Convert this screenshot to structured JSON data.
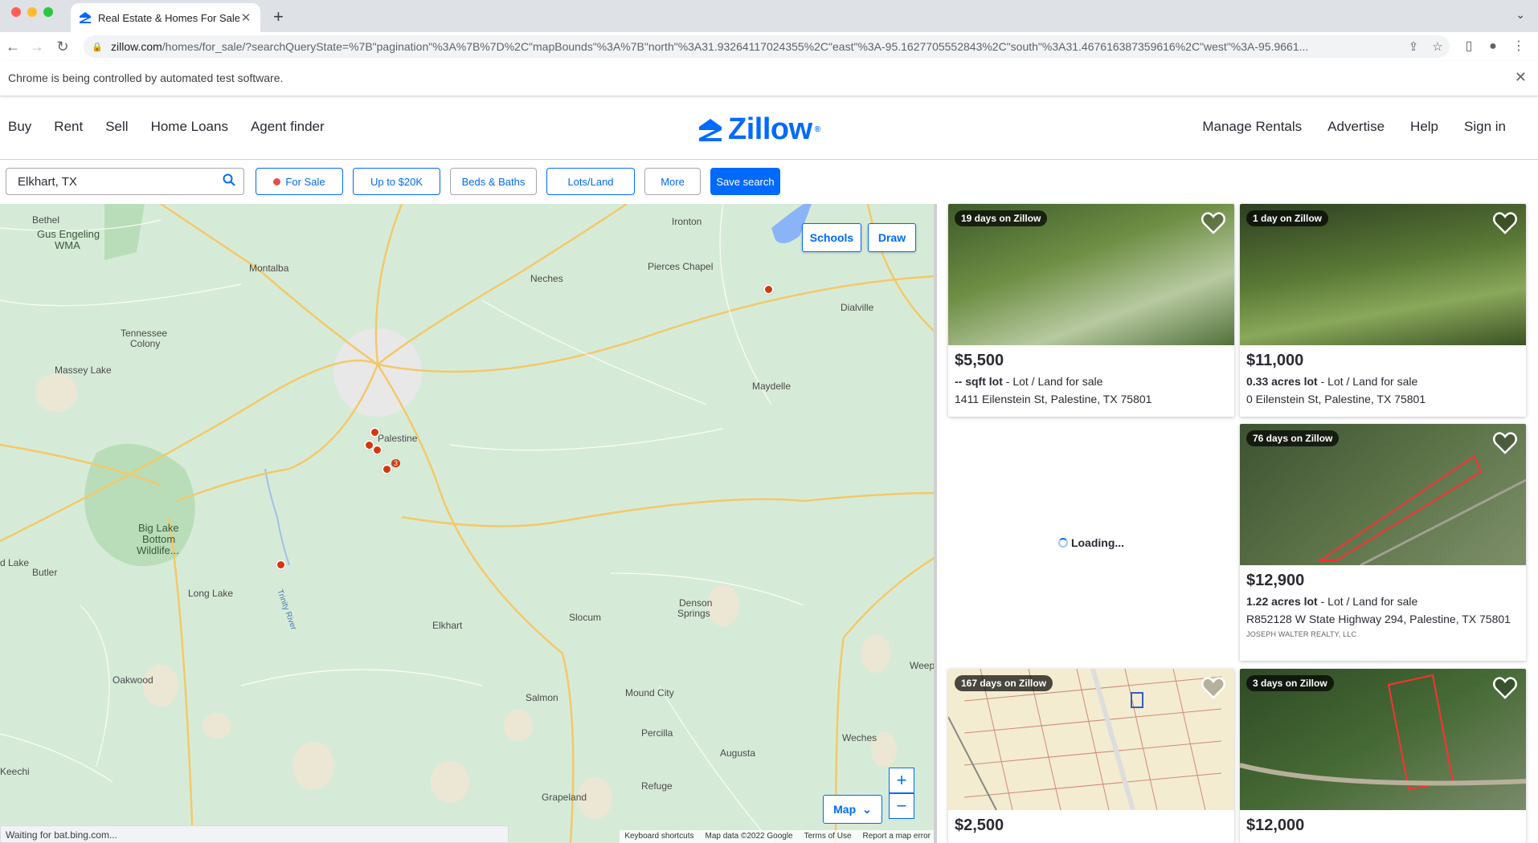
{
  "browser": {
    "tab_title": "Real Estate & Homes For Sale",
    "url_host": "zillow.com",
    "url_path": "/homes/for_sale/?searchQueryState=%7B\"pagination\"%3A%7B%7D%2C\"mapBounds\"%3A%7B\"north\"%3A31.93264117024355%2C\"east\"%3A-95.1627705552843%2C\"south\"%3A31.467616387359616%2C\"west\"%3A-95.9661...",
    "infobar_message": "Chrome is being controlled by automated test software.",
    "status_text": "Waiting for bat.bing.com..."
  },
  "header": {
    "nav_left": [
      "Buy",
      "Rent",
      "Sell",
      "Home Loans",
      "Agent finder"
    ],
    "logo_text": "Zillow",
    "nav_right": [
      "Manage Rentals",
      "Advertise",
      "Help",
      "Sign in"
    ]
  },
  "filters": {
    "search_value": "Elkhart, TX",
    "for_sale": "For Sale",
    "price": "Up to $20K",
    "beds_baths": "Beds & Baths",
    "home_type": "Lots/Land",
    "more": "More",
    "save_search": "Save search"
  },
  "map": {
    "schools_label": "Schools",
    "draw_label": "Draw",
    "map_type": "Map",
    "zoom_in": "+",
    "zoom_out": "−",
    "attribution": [
      "Keyboard shortcuts",
      "Map data ©2022 Google",
      "Terms of Use",
      "Report a map error"
    ],
    "places": {
      "bethel": "Bethel",
      "gus_engeling": "Gus Engeling",
      "wma": "WMA",
      "ironton": "Ironton",
      "montalba": "Montalba",
      "neches": "Neches",
      "pierces_chapel": "Pierces Chapel",
      "dialville": "Dialville",
      "tennessee": "Tennessee",
      "colony": "Colony",
      "massey_lake": "Massey Lake",
      "maydelle": "Maydelle",
      "palestine": "Palestine",
      "big_lake": "Big Lake",
      "bottom": "Bottom",
      "wildlife": "Wildlife...",
      "d_lake": "d Lake",
      "butler": "Butler",
      "long_lake": "Long Lake",
      "trinity_river": "Trinity River",
      "elkhart": "Elkhart",
      "slocum": "Slocum",
      "denson": "Denson",
      "springs": "Springs",
      "oakwood": "Oakwood",
      "salmon": "Salmon",
      "mound_city": "Mound City",
      "percilla": "Percilla",
      "weches": "Weches",
      "augusta": "Augusta",
      "keechi": "Keechi",
      "grapeland": "Grapeland",
      "refuge": "Refuge",
      "weep": "Weep"
    },
    "cluster_count": "3"
  },
  "listings": [
    {
      "badge": "19 days on Zillow",
      "price": "$5,500",
      "size": "-- sqft lot",
      "type": " - Lot / Land for sale",
      "address": "1411 Eilenstein St, Palestine, TX 75801",
      "broker": ""
    },
    {
      "badge": "1 day on Zillow",
      "price": "$11,000",
      "size": "0.33 acres lot",
      "type": " - Lot / Land for sale",
      "address": "0 Eilenstein St, Palestine, TX 75801",
      "broker": ""
    },
    {
      "badge": "76 days on Zillow",
      "price": "$12,900",
      "size": "1.22 acres lot",
      "type": " - Lot / Land for sale",
      "address": "R852128 W State Highway 294, Palestine, TX 75801",
      "broker": "JOSEPH WALTER REALTY, LLC"
    },
    {
      "badge": "167 days on Zillow",
      "price": "$2,500",
      "size": "",
      "type": "",
      "address": "",
      "broker": ""
    },
    {
      "badge": "3 days on Zillow",
      "price": "$12,000",
      "size": "",
      "type": "",
      "address": "",
      "broker": ""
    }
  ],
  "loading_text": "Loading...",
  "colors": {
    "brand": "#006aff",
    "pin": "#d4380d",
    "map_bg": "#d6ebd7"
  }
}
